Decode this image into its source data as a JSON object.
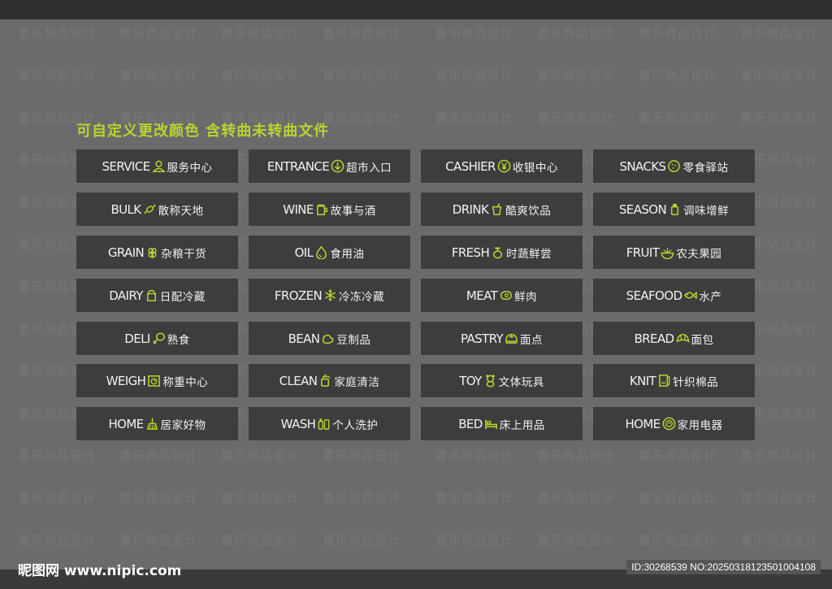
{
  "heading": "可自定义更改颜色  含转曲未转曲文件",
  "accent_color": "#b7d430",
  "watermark_text": "喜乐尚品设计",
  "site_logo": "昵图网 www.nipic.com",
  "image_id": "ID:30268539 NO:20250318123501004108",
  "signs": [
    {
      "en": "SERVICE",
      "zh": "服务中心",
      "icon": "person-service-icon"
    },
    {
      "en": "ENTRANCE",
      "zh": "超市入口",
      "icon": "entrance-arrow-icon"
    },
    {
      "en": "CASHIER",
      "zh": "收银中心",
      "icon": "yen-coin-icon"
    },
    {
      "en": "SNACKS",
      "zh": "零食驿站",
      "icon": "cookie-icon"
    },
    {
      "en": "BULK",
      "zh": "散称天地",
      "icon": "candy-icon"
    },
    {
      "en": "WINE",
      "zh": "故事与酒",
      "icon": "beer-mug-icon"
    },
    {
      "en": "DRINK",
      "zh": "酷爽饮品",
      "icon": "drink-cup-icon"
    },
    {
      "en": "SEASON",
      "zh": "调味增鲜",
      "icon": "seasoning-bottle-icon"
    },
    {
      "en": "GRAIN",
      "zh": "杂粮干货",
      "icon": "wheat-icon"
    },
    {
      "en": "OIL",
      "zh": "食用油",
      "icon": "oil-drop-icon"
    },
    {
      "en": "FRESH",
      "zh": "时蔬鲜尝",
      "icon": "vegetable-icon"
    },
    {
      "en": "FRUIT",
      "zh": "农夫果园",
      "icon": "watermelon-icon"
    },
    {
      "en": "DAIRY",
      "zh": "日配冷藏",
      "icon": "milk-carton-icon"
    },
    {
      "en": "FROZEN",
      "zh": "冷冻冷藏",
      "icon": "snowflake-icon"
    },
    {
      "en": "MEAT",
      "zh": "鲜肉",
      "icon": "meat-icon"
    },
    {
      "en": "SEAFOOD",
      "zh": "水产",
      "icon": "fish-icon"
    },
    {
      "en": "DELI",
      "zh": "熟食",
      "icon": "chicken-leg-icon"
    },
    {
      "en": "BEAN",
      "zh": "豆制品",
      "icon": "bean-icon"
    },
    {
      "en": "PASTRY",
      "zh": "面点",
      "icon": "bun-icon"
    },
    {
      "en": "BREAD",
      "zh": "面包",
      "icon": "croissant-icon"
    },
    {
      "en": "WEIGH",
      "zh": "称重中心",
      "icon": "scale-icon"
    },
    {
      "en": "CLEAN",
      "zh": "家庭清洁",
      "icon": "spray-bottle-icon"
    },
    {
      "en": "TOY",
      "zh": "文体玩具",
      "icon": "teddy-bear-icon"
    },
    {
      "en": "KNIT",
      "zh": "针织棉品",
      "icon": "towel-icon"
    },
    {
      "en": "HOME",
      "zh": "居家好物",
      "icon": "broom-icon"
    },
    {
      "en": "WASH",
      "zh": "个人洗护",
      "icon": "toiletry-bottles-icon"
    },
    {
      "en": "BED",
      "zh": "床上用品",
      "icon": "bed-icon"
    },
    {
      "en": "HOME",
      "zh": "家用电器",
      "icon": "appliance-icon"
    }
  ]
}
